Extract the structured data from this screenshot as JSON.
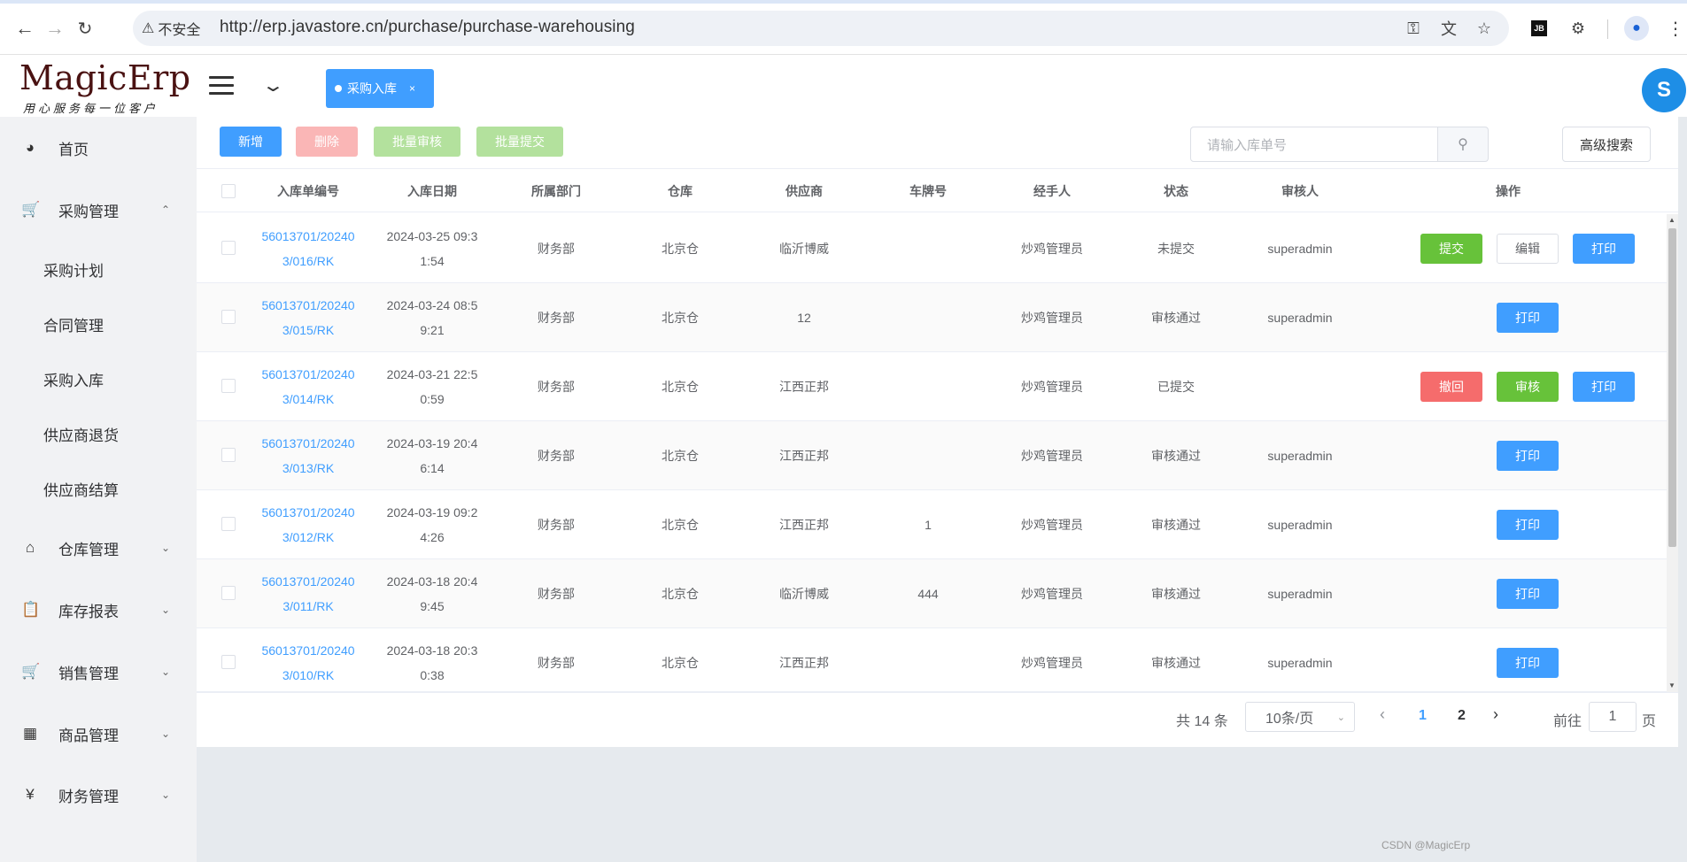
{
  "browser": {
    "insecure_label": "不安全",
    "url": "http://erp.javastore.cn/purchase/purchase-warehousing"
  },
  "header": {
    "logo_title": "MagicErp",
    "logo_subtitle": "用心服务每一位客户",
    "active_tab": "采购入库",
    "avatar_letter": "S"
  },
  "sidebar": {
    "items": [
      {
        "label": "首页",
        "icon": "dashboard-icon"
      },
      {
        "label": "采购管理",
        "icon": "cart-icon",
        "expanded": true
      },
      {
        "label": "采购计划"
      },
      {
        "label": "合同管理"
      },
      {
        "label": "采购入库"
      },
      {
        "label": "供应商退货"
      },
      {
        "label": "供应商结算"
      },
      {
        "label": "仓库管理",
        "icon": "warehouse-icon"
      },
      {
        "label": "库存报表",
        "icon": "clipboard-icon"
      },
      {
        "label": "销售管理",
        "icon": "cart-icon"
      },
      {
        "label": "商品管理",
        "icon": "grid-icon"
      },
      {
        "label": "财务管理",
        "icon": "yen-icon"
      }
    ]
  },
  "toolbar": {
    "add": "新增",
    "delete": "删除",
    "batch_audit": "批量审核",
    "batch_submit": "批量提交",
    "search_placeholder": "请输入库单号",
    "advanced_search": "高级搜索"
  },
  "table": {
    "headers": [
      "入库单编号",
      "入库日期",
      "所属部门",
      "仓库",
      "供应商",
      "车牌号",
      "经手人",
      "状态",
      "审核人",
      "操作"
    ],
    "rows": [
      {
        "no1": "56013701/20240",
        "no2": "3/016/RK",
        "d1": "2024-03-25 09:3",
        "d2": "1:54",
        "dept": "财务部",
        "wh": "北京仓",
        "sup": "临沂博威",
        "plate": "",
        "handler": "炒鸡管理员",
        "status": "未提交",
        "auditor": "superadmin",
        "actions": [
          "提交",
          "编辑",
          "打印"
        ]
      },
      {
        "no1": "56013701/20240",
        "no2": "3/015/RK",
        "d1": "2024-03-24 08:5",
        "d2": "9:21",
        "dept": "财务部",
        "wh": "北京仓",
        "sup": "12",
        "plate": "",
        "handler": "炒鸡管理员",
        "status": "审核通过",
        "auditor": "superadmin",
        "actions": [
          "打印"
        ]
      },
      {
        "no1": "56013701/20240",
        "no2": "3/014/RK",
        "d1": "2024-03-21 22:5",
        "d2": "0:59",
        "dept": "财务部",
        "wh": "北京仓",
        "sup": "江西正邦",
        "plate": "",
        "handler": "炒鸡管理员",
        "status": "已提交",
        "auditor": "",
        "actions": [
          "撤回",
          "审核",
          "打印"
        ]
      },
      {
        "no1": "56013701/20240",
        "no2": "3/013/RK",
        "d1": "2024-03-19 20:4",
        "d2": "6:14",
        "dept": "财务部",
        "wh": "北京仓",
        "sup": "江西正邦",
        "plate": "",
        "handler": "炒鸡管理员",
        "status": "审核通过",
        "auditor": "superadmin",
        "actions": [
          "打印"
        ]
      },
      {
        "no1": "56013701/20240",
        "no2": "3/012/RK",
        "d1": "2024-03-19 09:2",
        "d2": "4:26",
        "dept": "财务部",
        "wh": "北京仓",
        "sup": "江西正邦",
        "plate": "1",
        "handler": "炒鸡管理员",
        "status": "审核通过",
        "auditor": "superadmin",
        "actions": [
          "打印"
        ]
      },
      {
        "no1": "56013701/20240",
        "no2": "3/011/RK",
        "d1": "2024-03-18 20:4",
        "d2": "9:45",
        "dept": "财务部",
        "wh": "北京仓",
        "sup": "临沂博威",
        "plate": "444",
        "handler": "炒鸡管理员",
        "status": "审核通过",
        "auditor": "superadmin",
        "actions": [
          "打印"
        ]
      },
      {
        "no1": "56013701/20240",
        "no2": "3/010/RK",
        "d1": "2024-03-18 20:3",
        "d2": "0:38",
        "dept": "财务部",
        "wh": "北京仓",
        "sup": "江西正邦",
        "plate": "",
        "handler": "炒鸡管理员",
        "status": "审核通过",
        "auditor": "superadmin",
        "actions": [
          "打印"
        ]
      }
    ]
  },
  "pagination": {
    "total": "共 14 条",
    "page_size": "10条/页",
    "pages": [
      "1",
      "2"
    ],
    "current": "1",
    "goto_label": "前往",
    "goto_value": "1",
    "page_suffix": "页"
  },
  "colors": {
    "primary": "#409eff",
    "success": "#67c23a",
    "danger": "#f56c6c"
  },
  "watermark": "CSDN @MagicErp"
}
